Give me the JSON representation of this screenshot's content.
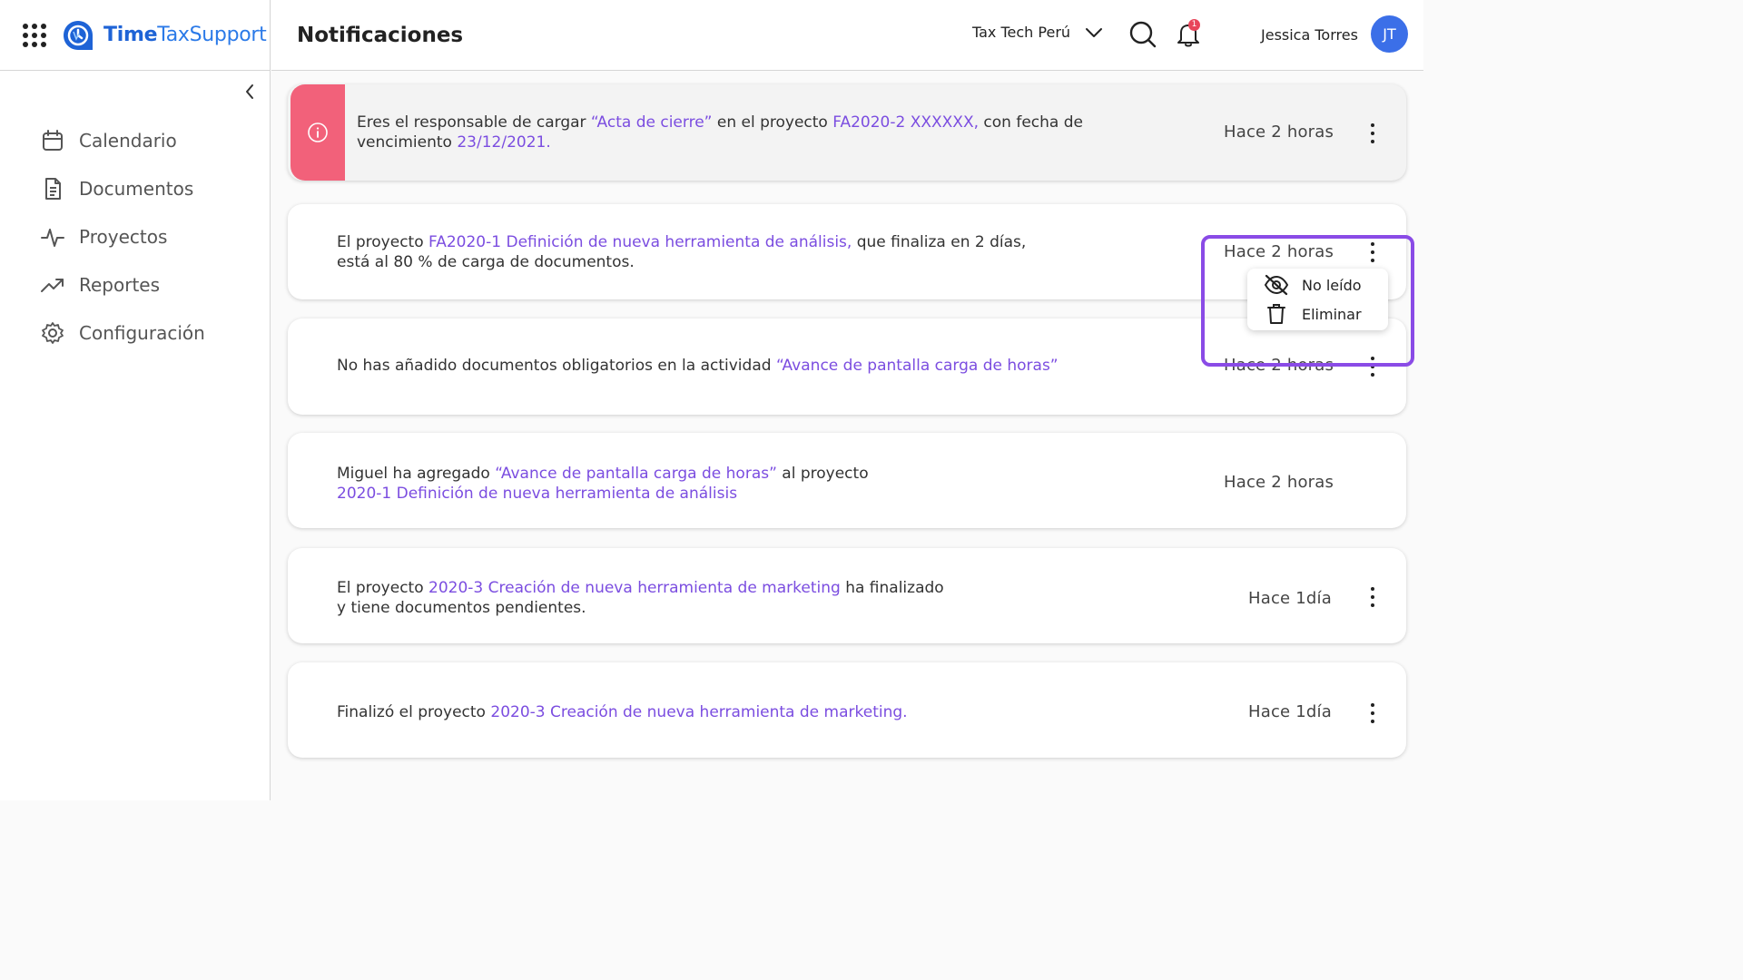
{
  "app": {
    "brand_part1": "Time",
    "brand_part2": "TaxSupport"
  },
  "sidebar": {
    "items": [
      {
        "label": "Calendario",
        "icon": "calendar-icon"
      },
      {
        "label": "Documentos",
        "icon": "document-icon"
      },
      {
        "label": "Proyectos",
        "icon": "activity-icon"
      },
      {
        "label": "Reportes",
        "icon": "trending-icon"
      },
      {
        "label": "Configuración",
        "icon": "gear-icon"
      }
    ]
  },
  "header": {
    "title": "Notificaciones",
    "company": "Tax Tech Perú",
    "notification_count": "1",
    "user_name": "Jessica Torres",
    "user_initials": "JT"
  },
  "notifications": [
    {
      "highlighted": true,
      "parts": [
        "Eres el responsable de cargar ",
        "“Acta de cierre”",
        " en el proyecto ",
        "FA2020-2 XXXXXX,",
        " con fecha de",
        "vencimiento ",
        "23/12/2021."
      ],
      "time": "Hace 2 horas"
    },
    {
      "parts": [
        "El proyecto ",
        "FA2020-1 Definición de nueva herramienta de análisis,",
        " que finaliza en 2 días,",
        "está al 80 % de carga de documentos."
      ],
      "time": "Hace 2 horas"
    },
    {
      "parts": [
        "No has añadido documentos obligatorios en la actividad ",
        "“Avance de pantalla carga de horas”"
      ],
      "time": "Hace 2 horas"
    },
    {
      "parts": [
        "Miguel ha agregado ",
        "“Avance de pantalla carga de horas”",
        " al proyecto",
        "2020-1 Definición de nueva herramienta de análisis"
      ],
      "time": "Hace 2 horas"
    },
    {
      "parts": [
        "El proyecto ",
        "2020-3 Creación de nueva herramienta de marketing",
        " ha finalizado",
        "y tiene documentos pendientes."
      ],
      "time": "Hace 1día"
    },
    {
      "parts": [
        "Finalizó el proyecto ",
        "2020-3 Creación de nueva herramienta de marketing."
      ],
      "time": "Hace 1día"
    }
  ],
  "context_menu": {
    "items": [
      {
        "label": "No leído",
        "icon": "eye-off-icon"
      },
      {
        "label": "Eliminar",
        "icon": "trash-icon"
      }
    ]
  },
  "colors": {
    "link": "#7b4de0",
    "alert": "#f2617a",
    "brand": "#1e63d6",
    "avatar": "#3b6fe8",
    "focus_frame": "#8a4be6"
  }
}
